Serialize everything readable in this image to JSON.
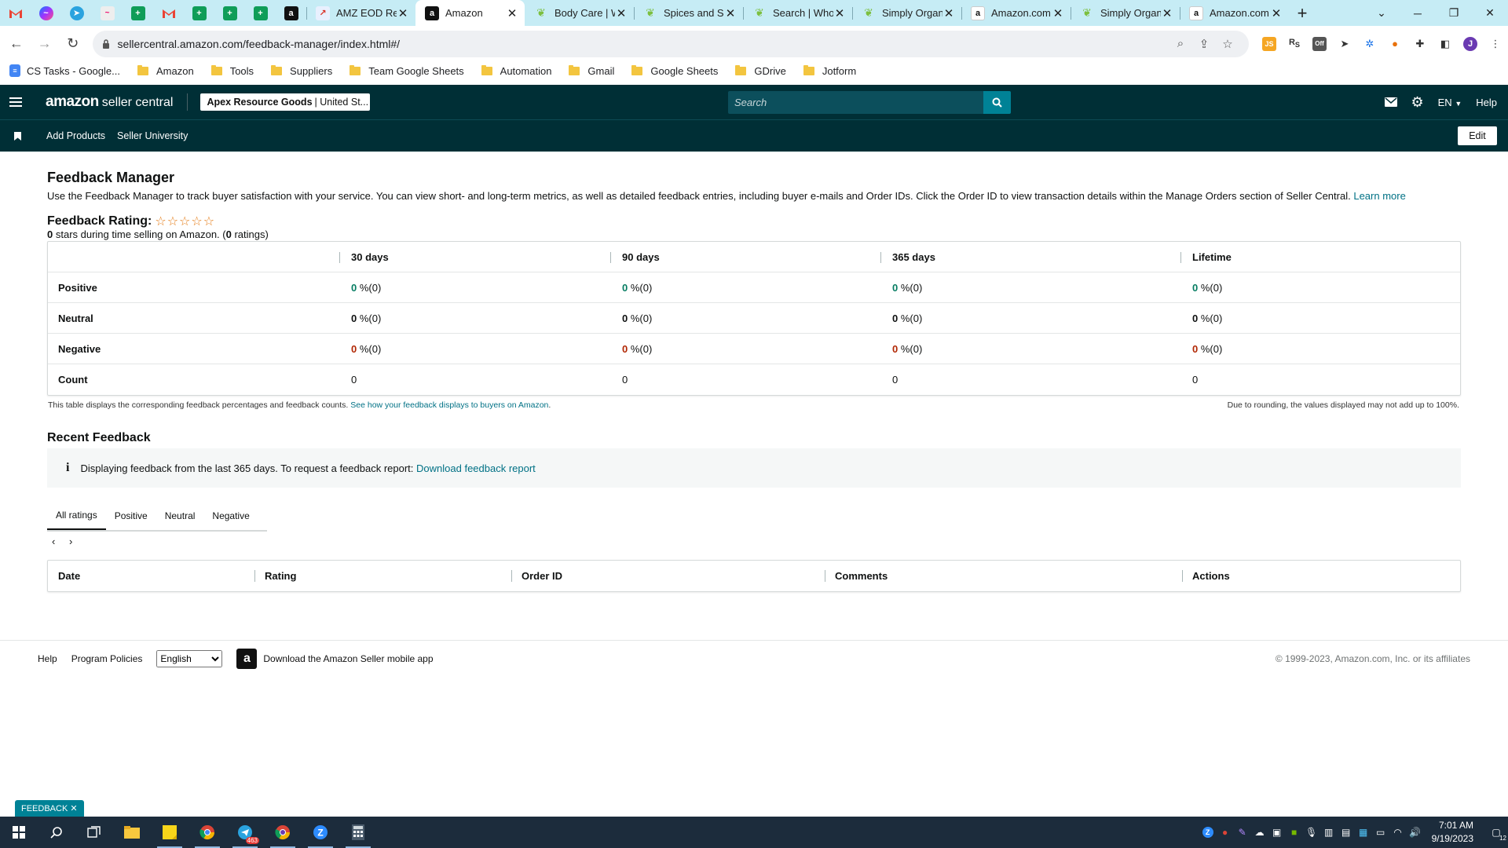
{
  "browser": {
    "tabs": [
      {
        "label": "AMZ EOD Rep",
        "favicon": "red-chart-icon"
      },
      {
        "label": "Amazon",
        "favicon": "amazon-a-icon",
        "active": true
      },
      {
        "label": "Body Care | W",
        "favicon": "leaf-icon"
      },
      {
        "label": "Spices and Se",
        "favicon": "leaf-icon"
      },
      {
        "label": "Search | Whol",
        "favicon": "leaf-icon"
      },
      {
        "label": "Simply Organ",
        "favicon": "leaf-icon"
      },
      {
        "label": "Amazon.com:",
        "favicon": "amazon-a-icon"
      },
      {
        "label": "Simply Organ",
        "favicon": "leaf-icon"
      },
      {
        "label": "Amazon.com:",
        "favicon": "amazon-a-icon"
      }
    ],
    "url": "sellercentral.amazon.com/feedback-manager/index.html#/",
    "bookmarks": [
      "CS Tasks - Google...",
      "Amazon",
      "Tools",
      "Suppliers",
      "Team Google Sheets",
      "Automation",
      "Gmail",
      "Google Sheets",
      "GDrive",
      "Jotform"
    ],
    "profile_initial": "J"
  },
  "header": {
    "brand_amazon": "amazon",
    "brand_sc": "seller central",
    "account_name": "Apex Resource Goods",
    "account_region": "| United St...",
    "search_placeholder": "Search",
    "language": "EN",
    "help": "Help",
    "subnav": [
      "Add Products",
      "Seller University"
    ],
    "edit": "Edit"
  },
  "page": {
    "title": "Feedback Manager",
    "intro": "Use the Feedback Manager to track buyer satisfaction with your service. You can view short- and long-term metrics, as well as detailed feedback entries, including buyer e-mails and Order IDs. Click the Order ID to view transaction details within the Manage Orders section of Seller Central.",
    "learn_more": "Learn more",
    "rating_label": "Feedback Rating:",
    "stars": "☆☆☆☆☆",
    "rating_stars_value": "0",
    "rating_stars_text": " stars during time selling on Amazon. (",
    "rating_count": "0",
    "rating_count_suffix": " ratings)"
  },
  "metrics": {
    "columns": [
      "30 days",
      "90 days",
      "365 days",
      "Lifetime"
    ],
    "rows": [
      {
        "label": "Positive",
        "values": [
          "0",
          "0",
          "0",
          "0"
        ],
        "suffix": "%(0)"
      },
      {
        "label": "Neutral",
        "values": [
          "0",
          "0",
          "0",
          "0"
        ],
        "suffix": "%(0)"
      },
      {
        "label": "Negative",
        "values": [
          "0",
          "0",
          "0",
          "0"
        ],
        "suffix": "%(0)"
      }
    ],
    "count_label": "Count",
    "counts": [
      "0",
      "0",
      "0",
      "0"
    ],
    "note": "This table displays the corresponding feedback percentages and feedback counts.",
    "note_link": "See how your feedback displays to buyers on Amazon",
    "rounding_note": "Due to rounding, the values displayed may not add up to 100%."
  },
  "recent": {
    "heading": "Recent Feedback",
    "alert": "Displaying feedback from the last 365 days. To request a feedback report:",
    "alert_link": "Download feedback report",
    "tabs": [
      "All ratings",
      "Positive",
      "Neutral",
      "Negative"
    ],
    "table_columns": [
      "Date",
      "Rating",
      "Order ID",
      "Comments",
      "Actions"
    ]
  },
  "footer": {
    "help": "Help",
    "policies": "Program Policies",
    "language_selected": "English",
    "app": "Download the Amazon Seller mobile app",
    "copyright": "© 1999-2023, Amazon.com, Inc. or its affiliates"
  },
  "feedback_tab": "FEEDBACK",
  "taskbar": {
    "telegram_badge": "463",
    "time": "7:01 AM",
    "date": "9/19/2023",
    "notification_count": "12"
  },
  "colors": {
    "nav_bg": "#002f36",
    "search_btn": "#008296",
    "link": "#007185",
    "positive": "#067d62",
    "negative": "#b12704",
    "tabstrip": "#c6ecf5"
  }
}
